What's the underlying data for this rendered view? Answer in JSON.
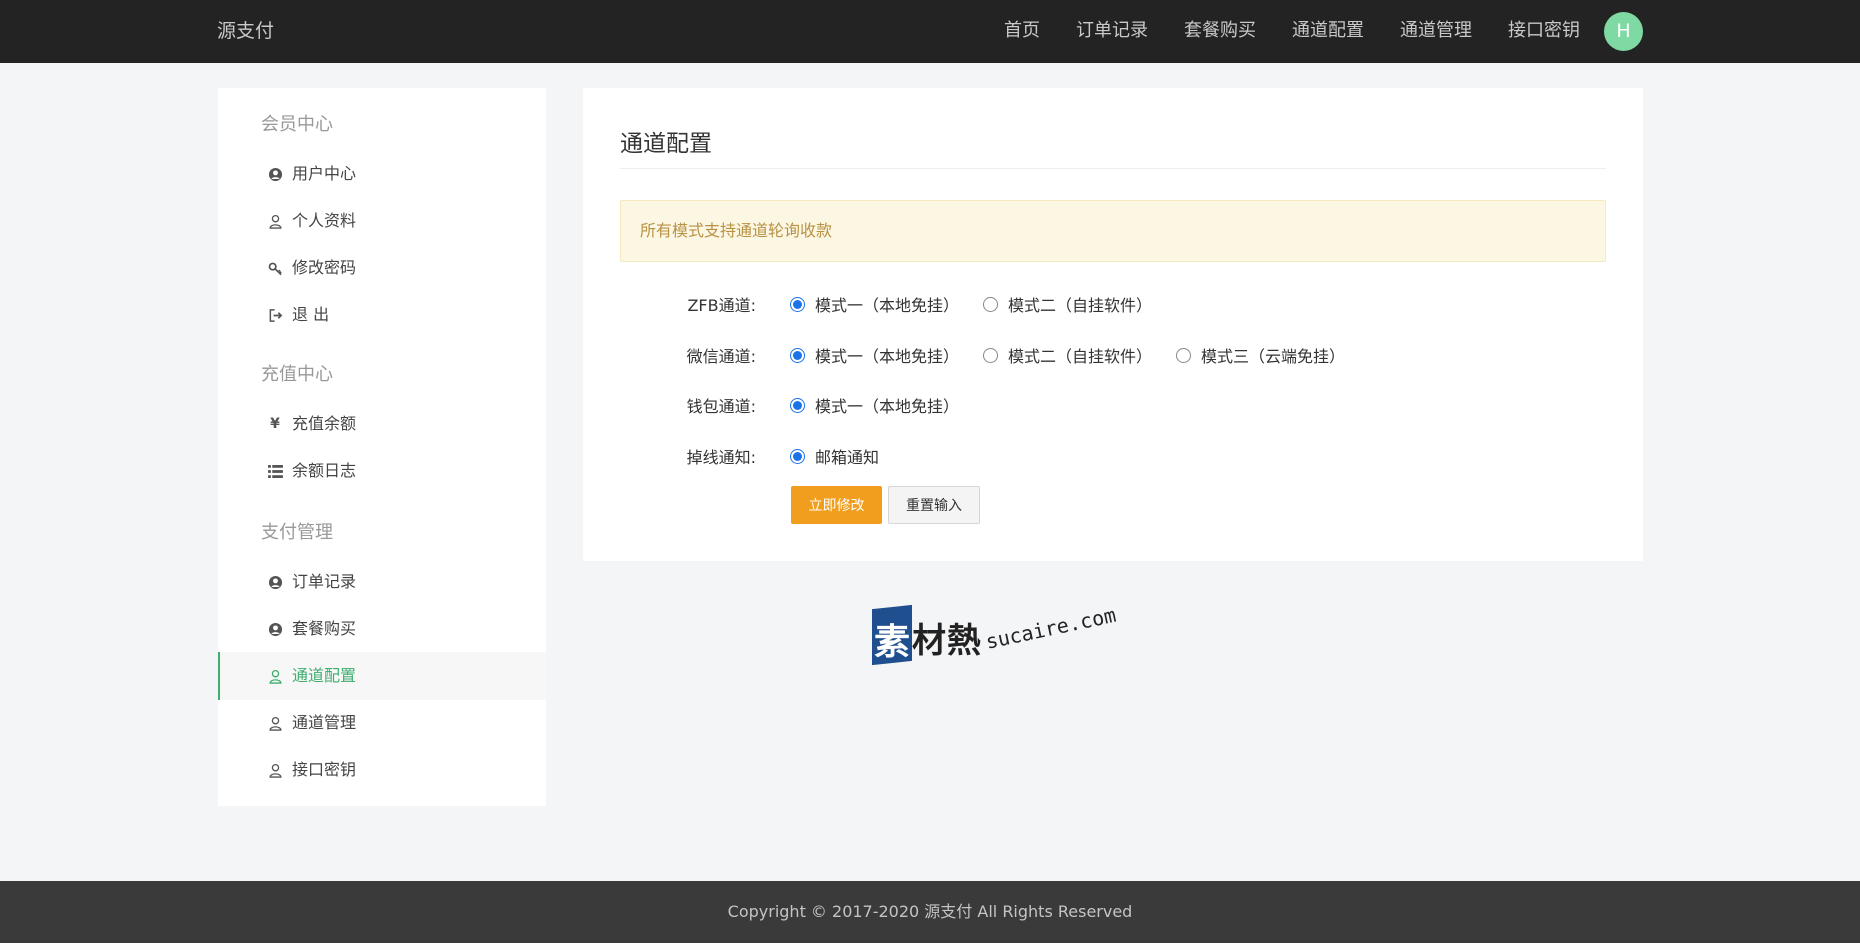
{
  "header": {
    "brand": "源支付",
    "nav": [
      "首页",
      "订单记录",
      "套餐购买",
      "通道配置",
      "通道管理",
      "接口密钥"
    ],
    "avatar_letter": "H",
    "avatar_color": "#7fd9a3"
  },
  "sidebar": {
    "sections": [
      {
        "title": "会员中心",
        "items": [
          {
            "label": "用户中心",
            "icon": "user-circle-icon"
          },
          {
            "label": "个人资料",
            "icon": "user-icon"
          },
          {
            "label": "修改密码",
            "icon": "key-icon"
          },
          {
            "label": "退 出",
            "icon": "sign-out-icon"
          }
        ]
      },
      {
        "title": "充值中心",
        "items": [
          {
            "label": "充值余额",
            "icon": "yen-icon"
          },
          {
            "label": "余额日志",
            "icon": "list-icon"
          }
        ]
      },
      {
        "title": "支付管理",
        "items": [
          {
            "label": "订单记录",
            "icon": "user-circle-icon"
          },
          {
            "label": "套餐购买",
            "icon": "user-circle-icon"
          },
          {
            "label": "通道配置",
            "icon": "user-icon",
            "active": true
          },
          {
            "label": "通道管理",
            "icon": "user-icon"
          },
          {
            "label": "接口密钥",
            "icon": "user-icon"
          }
        ]
      }
    ],
    "active_color": "#3fae6f"
  },
  "main": {
    "title": "通道配置",
    "notice": "所有模式支持通道轮询收款",
    "rows": [
      {
        "label": "ZFB通道:",
        "options": [
          {
            "text": "模式一（本地免挂）",
            "checked": true
          },
          {
            "text": "模式二（自挂软件）",
            "checked": false
          }
        ]
      },
      {
        "label": "微信通道:",
        "options": [
          {
            "text": "模式一（本地免挂）",
            "checked": true
          },
          {
            "text": "模式二（自挂软件）",
            "checked": false
          },
          {
            "text": "模式三（云端免挂）",
            "checked": false
          }
        ]
      },
      {
        "label": "钱包通道:",
        "options": [
          {
            "text": "模式一（本地免挂）",
            "checked": true
          }
        ]
      },
      {
        "label": "掉线通知:",
        "options": [
          {
            "text": "邮箱通知",
            "checked": true
          }
        ]
      }
    ],
    "submit_label": "立即修改",
    "reset_label": "重置输入",
    "submit_color": "#f19e1e"
  },
  "watermark": {
    "cn_first": "素",
    "cn_rest": "材熱",
    "en": "sucaire.com"
  },
  "footer": {
    "text": "Copyright © 2017-2020 源支付 All Rights Reserved"
  }
}
